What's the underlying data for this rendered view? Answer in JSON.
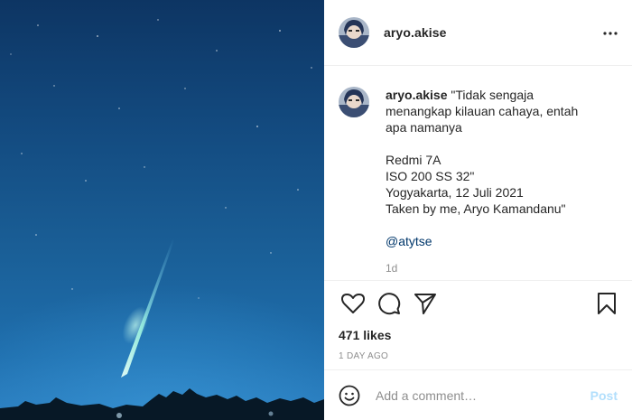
{
  "post": {
    "image_alt": "Meteor streak in the night sky over trees",
    "author": "aryo.akise"
  },
  "header": {
    "username": "aryo.akise",
    "more_icon": "more-horizontal-icon"
  },
  "caption": {
    "username": "aryo.akise",
    "text": "\"Tidak sengaja menangkap kilauan cahaya, entah apa namanya\n\nRedmi 7A\nISO 200 SS 32\"\nYogyakarta, 12 Juli 2021\nTaken by me, Aryo Kamandanu\"",
    "mention": "@atytse",
    "age": "1d"
  },
  "actions": {
    "like_icon": "heart-icon",
    "comment_icon": "comment-icon",
    "share_icon": "share-icon",
    "save_icon": "bookmark-icon"
  },
  "likes": "471 likes",
  "timestamp": "1 DAY AGO",
  "comment": {
    "emoji_icon": "emoji-icon",
    "placeholder": "Add a comment…",
    "post_label": "Post"
  },
  "colors": {
    "text": "#262626",
    "muted": "#8e8e8e",
    "link": "#00376b",
    "post_disabled": "#b2dffc",
    "sky": "#1a5f97"
  }
}
